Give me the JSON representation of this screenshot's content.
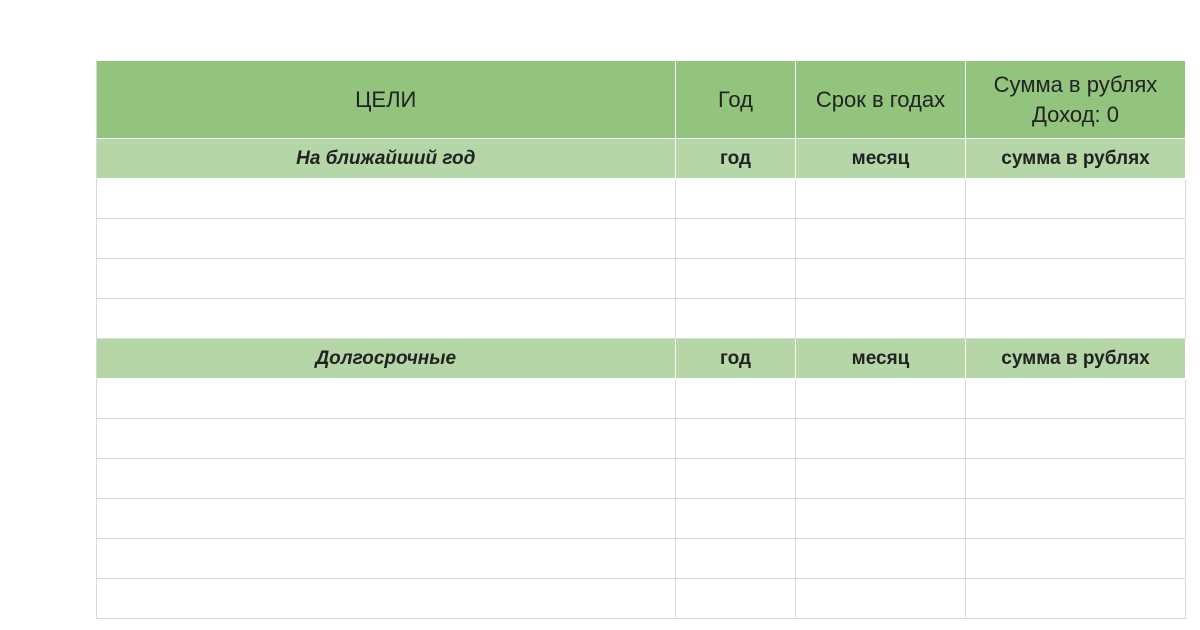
{
  "header": {
    "goals": "ЦЕЛИ",
    "year": "Год",
    "term": "Срок в годах",
    "sum_line1": "Сумма в рублях",
    "sum_line2": "Доход: 0"
  },
  "section1": {
    "title": "На ближайший год",
    "year": "год",
    "term": "месяц",
    "sum": "сумма в рублях",
    "rows": [
      {
        "goal": "",
        "year": "",
        "term": "",
        "sum": ""
      },
      {
        "goal": "",
        "year": "",
        "term": "",
        "sum": ""
      },
      {
        "goal": "",
        "year": "",
        "term": "",
        "sum": ""
      },
      {
        "goal": "",
        "year": "",
        "term": "",
        "sum": ""
      }
    ]
  },
  "section2": {
    "title": "Долгосрочные",
    "year": "год",
    "term": "месяц",
    "sum": "сумма в рублях",
    "rows": [
      {
        "goal": "",
        "year": "",
        "term": "",
        "sum": ""
      },
      {
        "goal": "",
        "year": "",
        "term": "",
        "sum": ""
      },
      {
        "goal": "",
        "year": "",
        "term": "",
        "sum": ""
      },
      {
        "goal": "",
        "year": "",
        "term": "",
        "sum": ""
      },
      {
        "goal": "",
        "year": "",
        "term": "",
        "sum": ""
      },
      {
        "goal": "",
        "year": "",
        "term": "",
        "sum": ""
      }
    ]
  }
}
